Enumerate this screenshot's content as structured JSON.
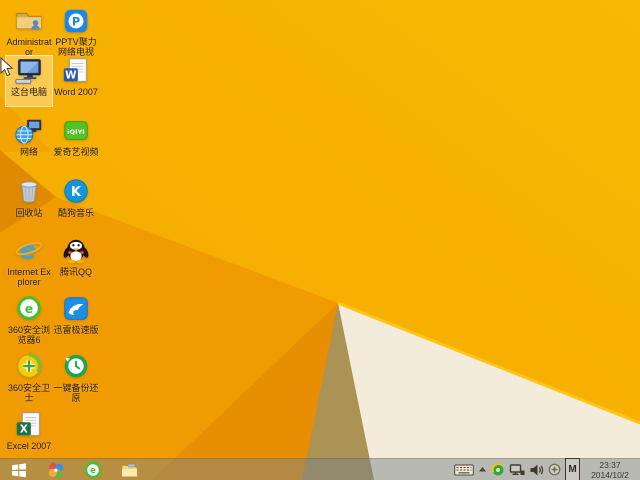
{
  "colors": {
    "wp_base_light": "#F9B802",
    "wp_base": "#F3A802",
    "wp_shade_topleft": "#F1A402",
    "wp_wedge": "#DF8A00",
    "wp_facet_mid": "#F09B02",
    "wp_facet_dark": "#E78E02",
    "wp_shadow_olive": "#AB9255",
    "wp_cream": "#F3ECDA",
    "wp_highlight_edge": "#FFC414",
    "taskbar_tint": "rgba(121,130,135,0.48)",
    "selection_fill": "rgba(255,241,200,0.42)",
    "selection_border": "rgba(255,252,235,0.75)",
    "icon_label": "#231805",
    "tray_text": "#3D3827"
  },
  "desktop": {
    "icons": [
      {
        "label": "Administrator",
        "icon": "user-folder-icon",
        "selected": false
      },
      {
        "label": "PPTV聚力 网络电视",
        "icon": "pptv-icon",
        "selected": false
      },
      {
        "label": "这台电脑",
        "icon": "this-pc-icon",
        "selected": true
      },
      {
        "label": "Word 2007",
        "icon": "word-icon",
        "selected": false
      },
      {
        "label": "网络",
        "icon": "network-icon",
        "selected": false
      },
      {
        "label": "爱奇艺视频",
        "icon": "iqiyi-icon",
        "selected": false
      },
      {
        "label": "回收站",
        "icon": "recycle-bin-icon",
        "selected": false
      },
      {
        "label": "酷狗音乐",
        "icon": "kugou-music-icon",
        "selected": false
      },
      {
        "label": "Internet Explorer",
        "icon": "internet-explorer-icon",
        "selected": false
      },
      {
        "label": "腾讯QQ",
        "icon": "tencent-qq-icon",
        "selected": false
      },
      {
        "label": "360安全浏览器6",
        "icon": "360-browser-icon",
        "selected": false
      },
      {
        "label": "迅雷极速版",
        "icon": "thunder-icon",
        "selected": false
      },
      {
        "label": "360安全卫士",
        "icon": "360-safeguard-icon",
        "selected": false
      },
      {
        "label": "一键备份还原",
        "icon": "backup-restore-icon",
        "selected": false
      },
      {
        "label": "Excel 2007",
        "icon": "excel-icon",
        "selected": false
      }
    ]
  },
  "taskbar": {
    "buttons": [
      "start",
      "360-software-manager",
      "360-browser",
      "file-explorer"
    ],
    "tray_icons": [
      "touch-keyboard",
      "show-hidden-icons-chevron",
      "360-tray",
      "wired-network",
      "volume",
      "remove-hardware",
      "ime-indicator"
    ],
    "ime_indicator": "M",
    "clock": {
      "time": "23:37",
      "date": "2014/10/2"
    }
  }
}
